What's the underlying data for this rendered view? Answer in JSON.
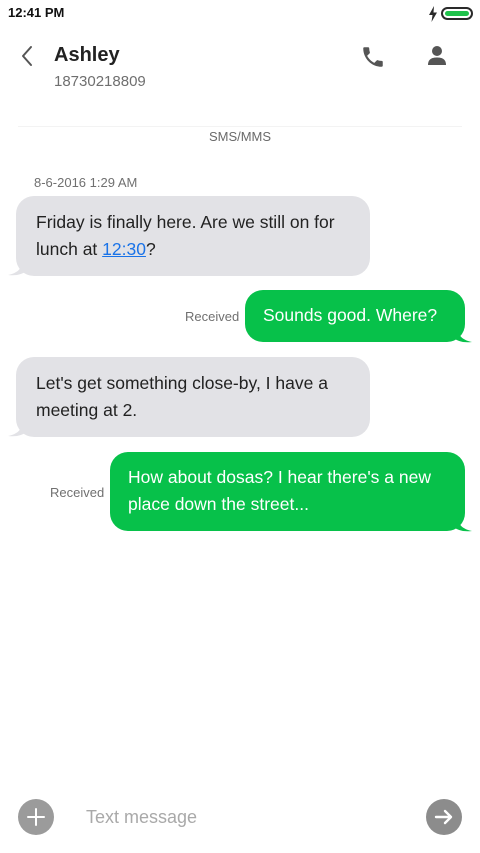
{
  "status_bar": {
    "time": "12:41 PM",
    "icons": [
      "charging-bolt-icon",
      "battery-icon"
    ],
    "battery_color": "#1fc24b"
  },
  "header": {
    "contact_name": "Ashley",
    "contact_number": "18730218809",
    "icons": [
      "back-arrow-icon",
      "phone-icon",
      "contact-icon"
    ]
  },
  "conversation": {
    "channel_label": "SMS/MMS",
    "timestamp": "8-6-2016 1:29 AM",
    "messages": [
      {
        "direction": "incoming",
        "text_before_link": "Friday is finally here. Are we still on for lunch at ",
        "link_text": "12:30",
        "text_after_link": "?"
      },
      {
        "direction": "outgoing",
        "status": "Received",
        "text": "Sounds good. Where?"
      },
      {
        "direction": "incoming",
        "text": "Let's get something close-by, I have a meeting at 2."
      },
      {
        "direction": "outgoing",
        "status": "Received",
        "text": "How about dosas? I hear there's a new place down the street..."
      }
    ]
  },
  "composer": {
    "placeholder": "Text message",
    "value": "",
    "icons": [
      "plus-icon",
      "send-arrow-icon"
    ]
  },
  "colors": {
    "outgoing_bubble": "#07c14a",
    "incoming_bubble": "#e2e2e6",
    "link": "#1a73e8"
  }
}
